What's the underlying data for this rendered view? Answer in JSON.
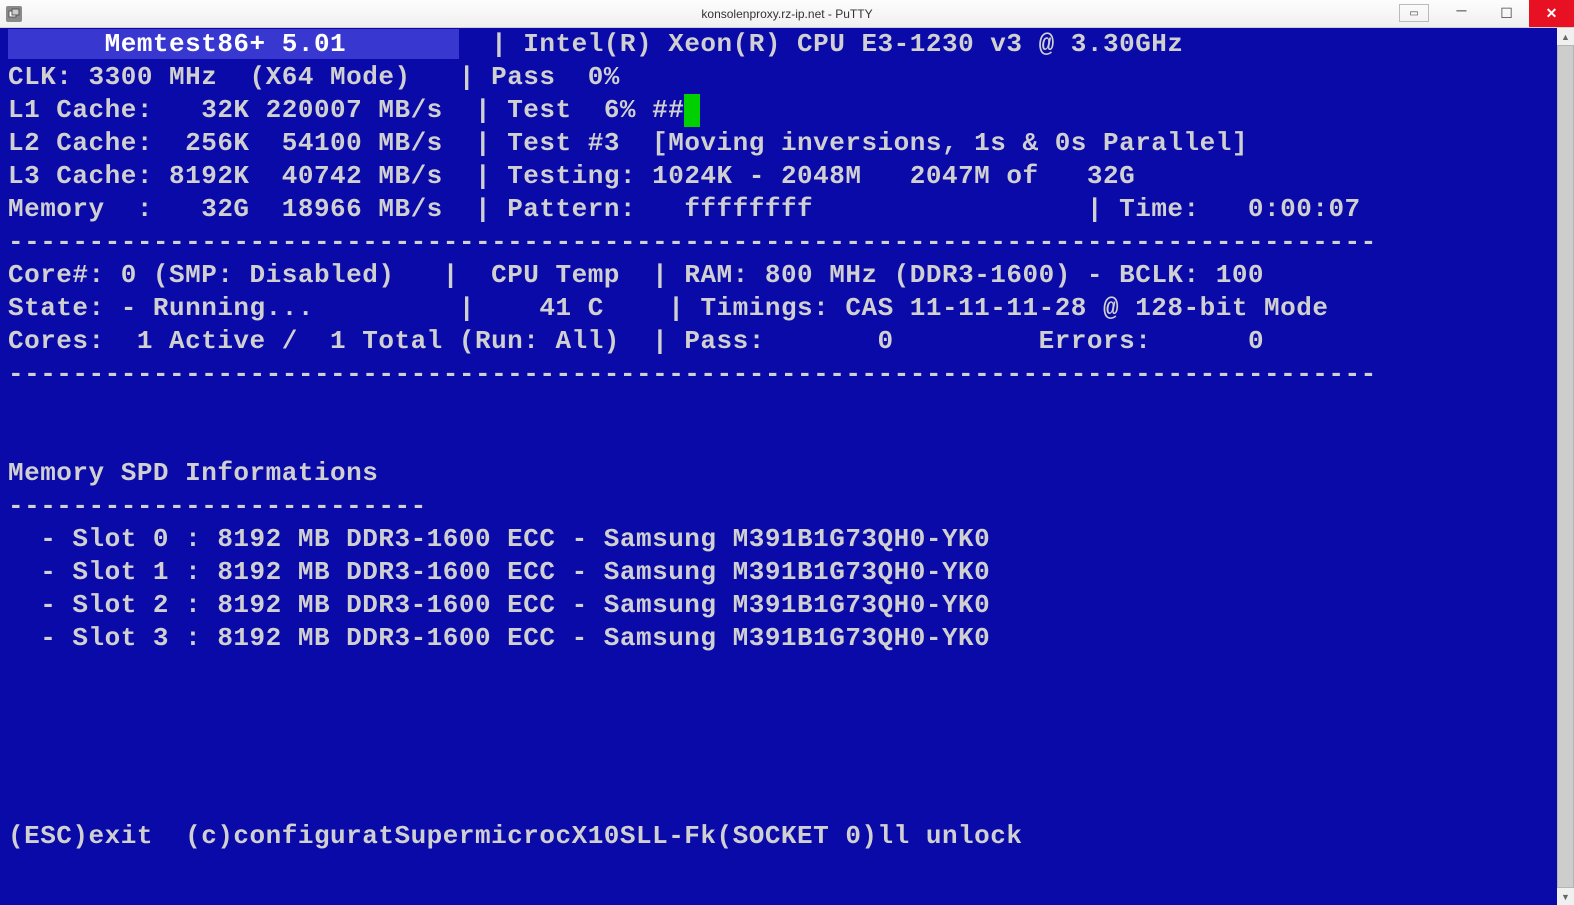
{
  "window": {
    "title": "konsolenproxy.rz-ip.net - PuTTY"
  },
  "header": {
    "app_name_line": "      Memtest86+ 5.01       ",
    "cpu": "Intel(R) Xeon(R) CPU E3-1230 v3 @ 3.30GHz",
    "clk": "CLK: 3300 MHz  (X64 Mode)",
    "pass_pct": "Pass  0%",
    "l1": "L1 Cache:   32K 220007 MB/s",
    "test_pct": "Test  6% ##",
    "l2": "L2 Cache:  256K  54100 MB/s",
    "test_name": "Test #3  [Moving inversions, 1s & 0s Parallel]",
    "l3": "L3 Cache: 8192K  40742 MB/s",
    "testing": "Testing: 1024K - 2048M   2047M of   32G",
    "memory": "Memory  :   32G  18966 MB/s",
    "pattern": "Pattern:   ffffffff",
    "time": "Time:   0:00:07"
  },
  "mid": {
    "core": "Core#: 0 (SMP: Disabled)",
    "cpu_temp_label": "CPU Temp",
    "ram": "RAM: 800 MHz (DDR3-1600) - BCLK: 100",
    "state": "State: - Running...",
    "temp": "41 C",
    "timings": "Timings: CAS 11-11-11-28 @ 128-bit Mode",
    "cores": "Cores:  1 Active /  1 Total (Run: All)",
    "pass": "Pass:       0",
    "errors": "Errors:      0"
  },
  "spd": {
    "title": "Memory SPD Informations",
    "dash": "--------------------------",
    "slots": [
      "  - Slot 0 : 8192 MB DDR3-1600 ECC - Samsung M391B1G73QH0-YK0",
      "  - Slot 1 : 8192 MB DDR3-1600 ECC - Samsung M391B1G73QH0-YK0",
      "  - Slot 2 : 8192 MB DDR3-1600 ECC - Samsung M391B1G73QH0-YK0",
      "  - Slot 3 : 8192 MB DDR3-1600 ECC - Samsung M391B1G73QH0-YK0"
    ]
  },
  "footer": {
    "line": "(ESC)exit  (c)configuratSupermicrocX10SLL-Fk(SOCKET 0)ll unlock"
  },
  "sep": "-------------------------------------------------------------------------------------"
}
